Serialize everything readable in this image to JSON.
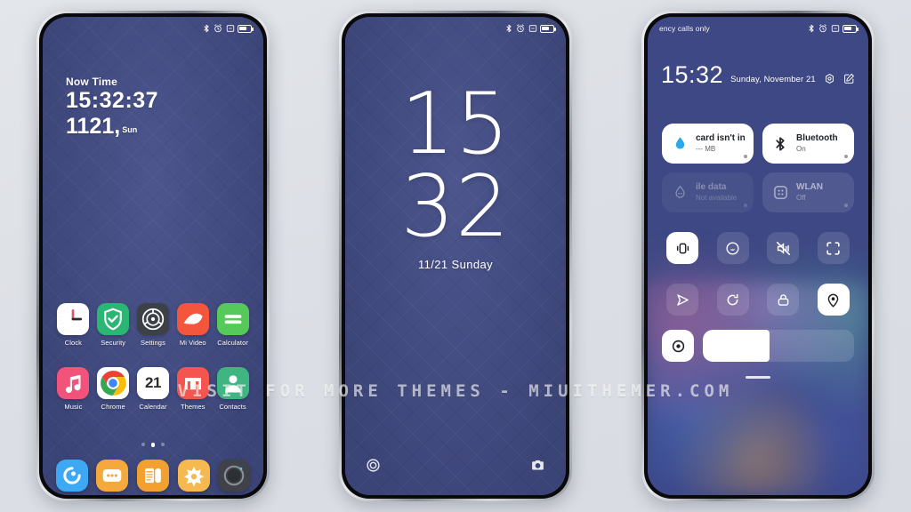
{
  "page": {
    "watermark": "VISIT FOR MORE THEMES - MIUITHEMER.COM",
    "background_color": "#dcdfe5",
    "wallpaper_color": "#434d87"
  },
  "phone1": {
    "name": "home-screen",
    "status_bar": {
      "left_text": "",
      "icons": [
        "bluetooth-icon",
        "alarm-icon",
        "dnd-icon",
        "battery-icon"
      ]
    },
    "widget": {
      "label": "Now Time",
      "time": "15:32:37",
      "date": "1121",
      "comma": ",",
      "day_of_week": "Sun"
    },
    "apps_row1": [
      {
        "label": "Clock",
        "icon": "clock-icon",
        "bg": "#ffffff"
      },
      {
        "label": "Security",
        "icon": "shield-icon",
        "bg": "#2bb673"
      },
      {
        "label": "Settings",
        "icon": "gear-icon",
        "bg": "#3c4148"
      },
      {
        "label": "Mi Video",
        "icon": "video-icon",
        "bg": "#f4553d"
      },
      {
        "label": "Calculator",
        "icon": "calculator-icon",
        "bg": "#56c95a"
      }
    ],
    "apps_row2": [
      {
        "label": "Music",
        "icon": "music-note-icon",
        "bg": "#f2537a"
      },
      {
        "label": "Chrome",
        "icon": "chrome-icon",
        "bg": "#ffffff"
      },
      {
        "label": "Calendar",
        "icon": "calendar-icon",
        "bg": "#ffffff",
        "day": "21"
      },
      {
        "label": "Themes",
        "icon": "themes-icon",
        "bg": "#f4564f"
      },
      {
        "label": "Contacts",
        "icon": "contacts-icon",
        "bg": "#3fb682"
      }
    ],
    "page_dots": {
      "count": 3,
      "active_index": 1
    },
    "dock": [
      {
        "name": "browser",
        "icon": "browser-icon",
        "bg": "#3da9f5"
      },
      {
        "name": "messages",
        "icon": "messages-icon",
        "bg": "#f5a93c"
      },
      {
        "name": "notes",
        "icon": "notes-icon",
        "bg": "#f2a030"
      },
      {
        "name": "gallery",
        "icon": "gallery-icon",
        "bg": "#f6b950"
      },
      {
        "name": "camera",
        "icon": "camera-icon",
        "bg": "#3f4248"
      }
    ]
  },
  "phone2": {
    "name": "lock-screen",
    "status_bar": {
      "left_text": "",
      "icons": [
        "bluetooth-icon",
        "alarm-icon",
        "dnd-icon",
        "battery-icon"
      ]
    },
    "clock": {
      "hours": "15",
      "minutes": "32",
      "date": "11/21  Sunday"
    },
    "shortcuts": [
      {
        "name": "flashlight-shortcut",
        "icon": "circle-icon"
      },
      {
        "name": "camera-shortcut",
        "icon": "camera-icon"
      }
    ]
  },
  "phone3": {
    "name": "notification-shade",
    "status_bar": {
      "left_text": "ency calls only",
      "icons": [
        "bluetooth-icon",
        "alarm-icon",
        "dnd-icon",
        "battery-icon"
      ]
    },
    "header": {
      "time": "15:32",
      "date": "Sunday, November 21",
      "actions": [
        "settings-icon",
        "edit-icon"
      ]
    },
    "cards": [
      {
        "title": "card isn't inste",
        "sub": "--- MB",
        "icon": "data-usage-icon",
        "state": "on"
      },
      {
        "title": "Bluetooth",
        "sub": "On",
        "icon": "bluetooth-icon",
        "state": "on"
      },
      {
        "title": "ile data",
        "sub": "Not available",
        "icon": "mobile-data-icon",
        "state": "dim"
      },
      {
        "title": "WLAN",
        "sub": "Off",
        "icon": "wlan-icon",
        "state": "off"
      }
    ],
    "toggles_row1": [
      {
        "name": "vibrate-toggle",
        "icon": "vibrate-icon",
        "state": "on"
      },
      {
        "name": "dark-mode-toggle",
        "icon": "moon-face-icon",
        "state": "off"
      },
      {
        "name": "mute-toggle",
        "icon": "mute-icon",
        "state": "off"
      },
      {
        "name": "scanner-toggle",
        "icon": "scan-icon",
        "state": "off"
      }
    ],
    "toggles_row2": [
      {
        "name": "airplane-toggle",
        "icon": "airplane-icon",
        "state": "off"
      },
      {
        "name": "sync-toggle",
        "icon": "sync-icon",
        "state": "off"
      },
      {
        "name": "lock-toggle",
        "icon": "lock-icon",
        "state": "off"
      },
      {
        "name": "location-toggle",
        "icon": "location-icon",
        "state": "on"
      }
    ],
    "brightness": {
      "name": "brightness-slider",
      "icon": "brightness-icon",
      "level_percent": 44
    }
  }
}
